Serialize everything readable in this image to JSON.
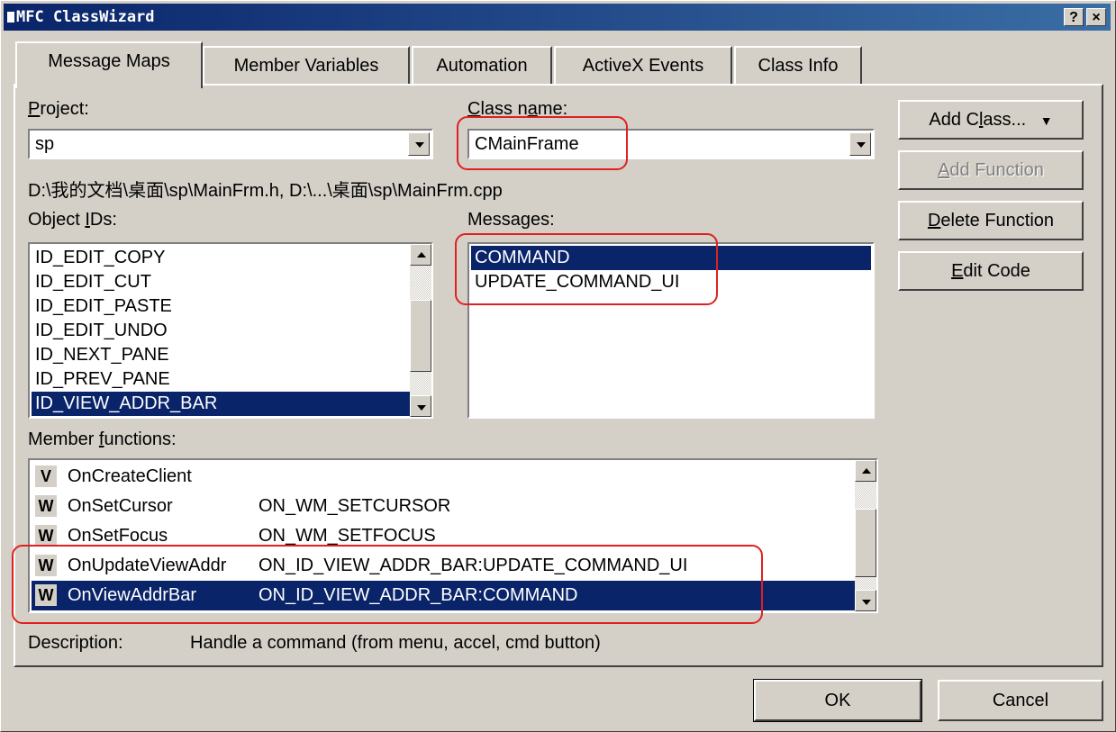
{
  "window": {
    "title": "MFC ClassWizard",
    "help_label": "?",
    "close_label": "×"
  },
  "tabs": [
    {
      "label": "Message Maps",
      "active": true
    },
    {
      "label": "Member Variables"
    },
    {
      "label": "Automation"
    },
    {
      "label": "ActiveX Events"
    },
    {
      "label": "Class Info"
    }
  ],
  "project": {
    "label": "Project:",
    "value": "sp"
  },
  "classname": {
    "label": "Class name:",
    "value": "CMainFrame"
  },
  "files_path": "D:\\我的文档\\桌面\\sp\\MainFrm.h, D:\\...\\桌面\\sp\\MainFrm.cpp",
  "object_ids": {
    "label": "Object IDs:",
    "items": [
      "ID_EDIT_COPY",
      "ID_EDIT_CUT",
      "ID_EDIT_PASTE",
      "ID_EDIT_UNDO",
      "ID_NEXT_PANE",
      "ID_PREV_PANE",
      "ID_VIEW_ADDR_BAR"
    ],
    "selected": "ID_VIEW_ADDR_BAR"
  },
  "messages": {
    "label": "Messages:",
    "items": [
      "COMMAND",
      "UPDATE_COMMAND_UI"
    ],
    "selected": "COMMAND"
  },
  "member_functions": {
    "label": "Member functions:",
    "rows": [
      {
        "badge": "V",
        "name": "OnCreateClient",
        "map": ""
      },
      {
        "badge": "W",
        "name": "OnSetCursor",
        "map": "ON_WM_SETCURSOR"
      },
      {
        "badge": "W",
        "name": "OnSetFocus",
        "map": "ON_WM_SETFOCUS"
      },
      {
        "badge": "W",
        "name": "OnUpdateViewAddr",
        "map": "ON_ID_VIEW_ADDR_BAR:UPDATE_COMMAND_UI"
      },
      {
        "badge": "W",
        "name": "OnViewAddrBar",
        "map": "ON_ID_VIEW_ADDR_BAR:COMMAND"
      }
    ],
    "selected": "OnViewAddrBar"
  },
  "description": {
    "label": "Description:",
    "value": "Handle a command (from menu, accel, cmd button)"
  },
  "buttons": {
    "add_class": "Add Class...",
    "add_function": "Add Function",
    "delete_function": "Delete Function",
    "edit_code": "Edit Code",
    "ok": "OK",
    "cancel": "Cancel"
  },
  "colors": {
    "selection": "#0a246a",
    "annotation": "#e02020",
    "face": "#d4d0c8"
  }
}
